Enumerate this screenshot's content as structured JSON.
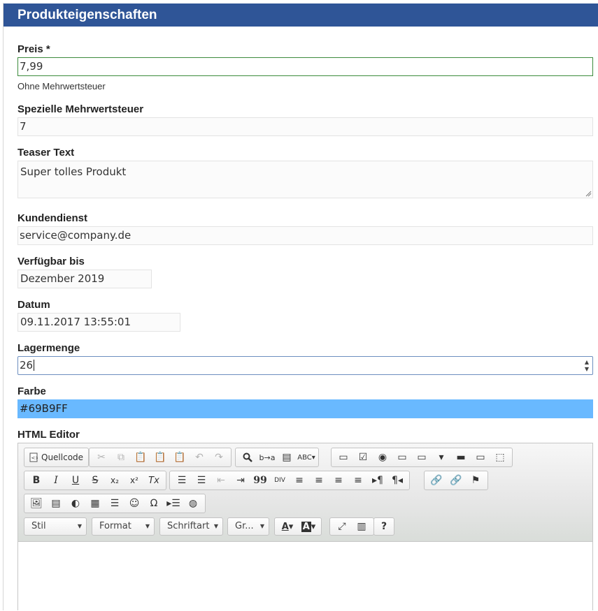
{
  "header": {
    "title": "Produkteigenschaften"
  },
  "fields": {
    "price": {
      "label": "Preis *",
      "value": "7,99",
      "help": "Ohne Mehrwertsteuer"
    },
    "vat": {
      "label": "Spezielle Mehrwertsteuer",
      "value": "7"
    },
    "teaser": {
      "label": "Teaser Text",
      "value": "Super tolles Produkt"
    },
    "support": {
      "label": "Kundendienst",
      "value": "service@company.de"
    },
    "available": {
      "label": "Verfügbar bis",
      "value": "Dezember 2019"
    },
    "date": {
      "label": "Datum",
      "value": "09.11.2017 13:55:01"
    },
    "stock": {
      "label": "Lagermenge",
      "value": "26"
    },
    "color": {
      "label": "Farbe",
      "value": "#69B9FF",
      "swatch": "#69B9FF"
    },
    "html": {
      "label": "HTML Editor"
    }
  },
  "editor": {
    "source_button": "Quellcode",
    "combos": {
      "style": "Stil",
      "format": "Format",
      "font": "Schriftart",
      "size": "Gr..."
    },
    "buttons": {
      "bold": "B",
      "italic": "I",
      "underline": "U",
      "strike": "S",
      "subscript": "x₂",
      "superscript": "x²",
      "remove_format": "Tx",
      "blockquote": "99",
      "special_char": "Ω",
      "help": "?"
    }
  },
  "colors": {
    "header_bg": "#2f5597",
    "valid_border": "#3c8b3c",
    "focus_border": "#6c8ebf"
  }
}
